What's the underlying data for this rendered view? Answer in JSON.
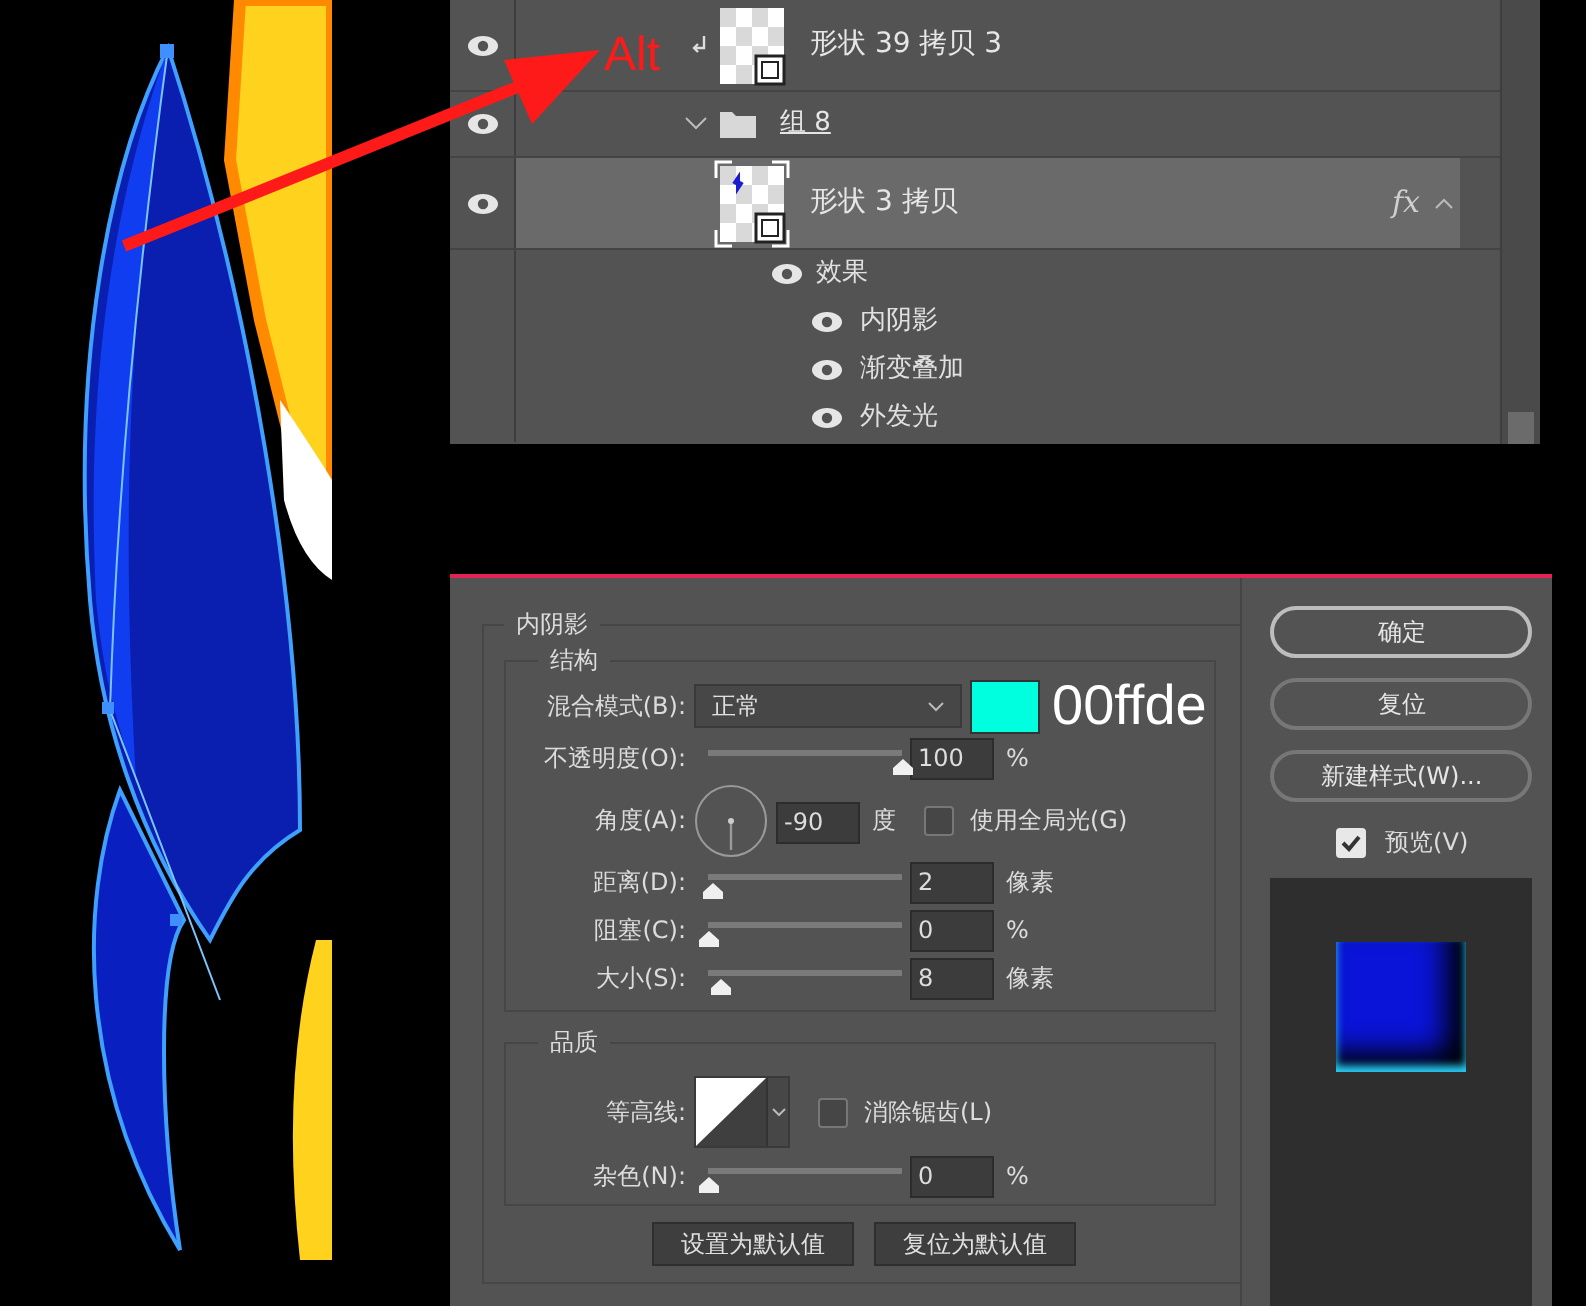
{
  "annotation": {
    "label": "Alt"
  },
  "layers": [
    {
      "kind": "layer",
      "name": "形状 39 拷贝 3",
      "visible": true,
      "clipped": true,
      "selected": false
    },
    {
      "kind": "group",
      "name": "组 8",
      "visible": true,
      "expanded": true,
      "selected": false
    },
    {
      "kind": "layer",
      "name": "形状 3 拷贝",
      "visible": true,
      "clipped": false,
      "selected": true,
      "fx": "fx"
    },
    {
      "kind": "effects",
      "name": "效果",
      "visible": true,
      "children": [
        {
          "name": "内阴影",
          "visible": true
        },
        {
          "name": "渐变叠加",
          "visible": true
        },
        {
          "name": "外发光",
          "visible": true
        }
      ]
    }
  ],
  "dialog": {
    "title": "内阴影",
    "structure": {
      "title": "结构",
      "rows": [
        {
          "kind": "select",
          "label": "混合模式(B):",
          "value": "正常",
          "color": "#00ffde",
          "note": "00ffde"
        },
        {
          "kind": "slider",
          "label": "不透明度(O):",
          "level": 1,
          "value": "100",
          "unit": "%"
        },
        {
          "kind": "angle",
          "label": "角度(A):",
          "value": "-90",
          "unit": "度",
          "checkbox": {
            "label": "使用全局光(G)",
            "checked": false
          }
        },
        {
          "kind": "slider",
          "label": "距离(D):",
          "level": 0.02,
          "value": "2",
          "unit": "像素"
        },
        {
          "kind": "slider",
          "label": "阻塞(C):",
          "level": 0,
          "value": "0",
          "unit": "%"
        },
        {
          "kind": "slider",
          "label": "大小(S):",
          "level": 0.06,
          "value": "8",
          "unit": "像素"
        }
      ]
    },
    "quality": {
      "title": "品质",
      "rows": [
        {
          "kind": "contour",
          "label": "等高线:",
          "checkbox": {
            "label": "消除锯齿(L)",
            "checked": false
          }
        },
        {
          "kind": "slider",
          "label": "杂色(N):",
          "level": 0,
          "value": "0",
          "unit": "%"
        }
      ]
    },
    "buttons": [
      "设置为默认值",
      "复位为默认值"
    ],
    "side_buttons": [
      {
        "label": "确定",
        "selected": true
      },
      {
        "label": "复位",
        "selected": false
      },
      {
        "label": "新建样式(W)...",
        "selected": false
      }
    ],
    "preview": {
      "label": "预览(V)",
      "checked": true
    }
  }
}
